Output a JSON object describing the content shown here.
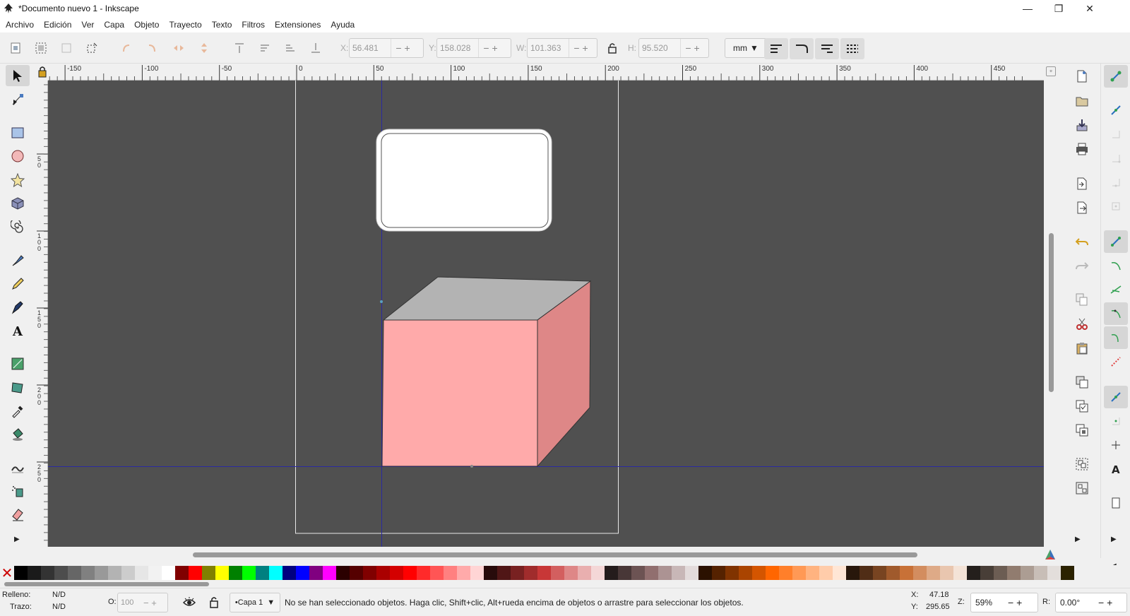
{
  "window": {
    "title": "*Documento nuevo 1 - Inkscape",
    "minimize_glyph": "—",
    "restore_glyph": "❐",
    "close_glyph": "✕"
  },
  "menu": [
    "Archivo",
    "Edición",
    "Ver",
    "Capa",
    "Objeto",
    "Trayecto",
    "Texto",
    "Filtros",
    "Extensiones",
    "Ayuda"
  ],
  "toolbar": {
    "x_label": "X:",
    "x_value": "56.481",
    "y_label": "Y:",
    "y_value": "158.028",
    "w_label": "W:",
    "w_value": "101.363",
    "h_label": "H:",
    "h_value": "95.520",
    "unit": "mm"
  },
  "ruler_top": [
    "-150",
    "-100",
    "-50",
    "0",
    "50",
    "100",
    "150",
    "200",
    "250",
    "300",
    "350",
    "400",
    "450"
  ],
  "ruler_left": [
    "5\n0",
    "1\n0\n0",
    "1\n5\n0",
    "2\n0\n0",
    "2\n5\n0"
  ],
  "tools": [
    "selector-icon",
    "node-icon",
    "rect-icon",
    "ellipse-icon",
    "star-icon",
    "box3d-icon",
    "spiral-icon",
    "pen-icon",
    "pencil-icon",
    "calligraphy-icon",
    "text-icon",
    "gradient-icon",
    "mesh-icon",
    "dropper-icon",
    "paint-bucket-icon",
    "tweak-icon",
    "spray-icon",
    "eraser-icon"
  ],
  "palette": {
    "colors": [
      "#000000",
      "#1a1a1a",
      "#333333",
      "#4d4d4d",
      "#666666",
      "#808080",
      "#999999",
      "#b3b3b3",
      "#cccccc",
      "#e6e6e6",
      "#f2f2f2",
      "#ffffff",
      "#800000",
      "#ff0000",
      "#808000",
      "#ffff00",
      "#008000",
      "#00ff00",
      "#008080",
      "#00ffff",
      "#000080",
      "#0000ff",
      "#800080",
      "#ff00ff",
      "#2b0000",
      "#550000",
      "#800000",
      "#aa0000",
      "#d40000",
      "#ff0000",
      "#ff2a2a",
      "#ff5555",
      "#ff8080",
      "#ffaaaa",
      "#ffd5d5",
      "#280b0b",
      "#501616",
      "#782121",
      "#a02c2c",
      "#c83737",
      "#d35f5f",
      "#de8787",
      "#e9afaf",
      "#f4d7d7",
      "#241c1c",
      "#483737",
      "#6c5353",
      "#916f6f",
      "#ac9393",
      "#c8b7b7",
      "#e3dbdb",
      "#2b1100",
      "#552200",
      "#803300",
      "#aa4400",
      "#d45500",
      "#ff6600",
      "#ff7f2a",
      "#ff9955",
      "#ffb380",
      "#ffccaa",
      "#ffe6d5",
      "#28170b",
      "#502d16",
      "#784421",
      "#a05a2c",
      "#c87137",
      "#d38d5f",
      "#deaa87",
      "#e9c6af",
      "#f4e3d7",
      "#241f1c",
      "#483e37",
      "#6c5d53",
      "#917c6f",
      "#ac9d93",
      "#c8beb7",
      "#e3dedb",
      "#2b2200"
    ]
  },
  "status": {
    "fill_label": "Relleno:",
    "fill_value": "N/D",
    "stroke_label": "Trazo:",
    "stroke_value": "N/D",
    "opacity_label": "O:",
    "opacity_value": "100",
    "layer": "•Capa 1",
    "message": "No se han seleccionado objetos. Haga clic, Shift+clic, Alt+rueda encima de objetos o arrastre para seleccionar los objetos.",
    "x_label": "X:",
    "x_value": "47.18",
    "y_label": "Y:",
    "y_value": "295.65",
    "zoom_label": "Z:",
    "zoom_value": "59%",
    "rotate_label": "R:",
    "rotate_value": "0.00°"
  },
  "colors": {
    "canvas": "#505050",
    "cube_front": "#ffaaaa",
    "cube_side": "#de8787",
    "cube_top": "#b3b3b3",
    "guide": "#2a2aa0"
  }
}
